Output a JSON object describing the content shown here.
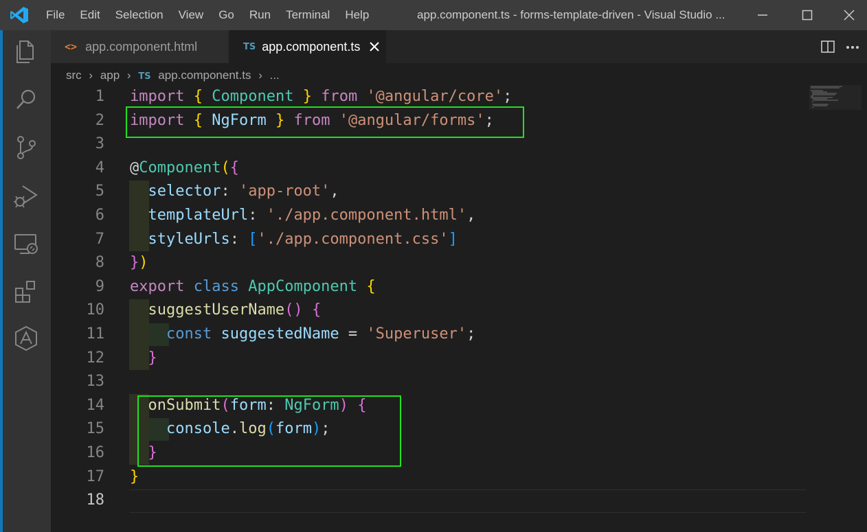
{
  "menu": [
    "File",
    "Edit",
    "Selection",
    "View",
    "Go",
    "Run",
    "Terminal",
    "Help"
  ],
  "window_title": "app.component.ts - forms-template-driven - Visual Studio ...",
  "tabs": [
    {
      "label": "app.component.html",
      "icon": "html-file-icon",
      "glyph": "<>",
      "active": false
    },
    {
      "label": "app.component.ts",
      "icon": "ts-file-icon",
      "glyph": "TS",
      "active": true
    }
  ],
  "breadcrumb": [
    "src",
    "app",
    "TS",
    "app.component.ts",
    "..."
  ],
  "line_numbers": [
    "1",
    "2",
    "3",
    "4",
    "5",
    "6",
    "7",
    "8",
    "9",
    "10",
    "11",
    "12",
    "13",
    "14",
    "15",
    "16",
    "17",
    "18"
  ],
  "code_lines": [
    [
      [
        "kw-import",
        "import"
      ],
      [
        "punc",
        " "
      ],
      [
        "b1",
        "{"
      ],
      [
        "punc",
        " "
      ],
      [
        "cls",
        "Component"
      ],
      [
        "punc",
        " "
      ],
      [
        "b1",
        "}"
      ],
      [
        "punc",
        " "
      ],
      [
        "kw-import",
        "from"
      ],
      [
        "punc",
        " "
      ],
      [
        "str",
        "'@angular/core'"
      ],
      [
        "punc",
        ";"
      ]
    ],
    [
      [
        "kw-import",
        "import"
      ],
      [
        "punc",
        " "
      ],
      [
        "b1",
        "{"
      ],
      [
        "punc",
        " "
      ],
      [
        "prop",
        "NgForm"
      ],
      [
        "punc",
        " "
      ],
      [
        "b1",
        "}"
      ],
      [
        "punc",
        " "
      ],
      [
        "kw-import",
        "from"
      ],
      [
        "punc",
        " "
      ],
      [
        "str",
        "'@angular/forms'"
      ],
      [
        "punc",
        ";"
      ]
    ],
    [],
    [
      [
        "punc",
        "@"
      ],
      [
        "cls",
        "Component"
      ],
      [
        "b1",
        "("
      ],
      [
        "b2",
        "{"
      ]
    ],
    [
      [
        "punc",
        "  "
      ],
      [
        "prop",
        "selector"
      ],
      [
        "punc",
        ": "
      ],
      [
        "str",
        "'app-root'"
      ],
      [
        "punc",
        ","
      ]
    ],
    [
      [
        "punc",
        "  "
      ],
      [
        "prop",
        "templateUrl"
      ],
      [
        "punc",
        ": "
      ],
      [
        "str",
        "'./app.component.html'"
      ],
      [
        "punc",
        ","
      ]
    ],
    [
      [
        "punc",
        "  "
      ],
      [
        "prop",
        "styleUrls"
      ],
      [
        "punc",
        ": "
      ],
      [
        "b3",
        "["
      ],
      [
        "str",
        "'./app.component.css'"
      ],
      [
        "b3",
        "]"
      ]
    ],
    [
      [
        "b2",
        "}"
      ],
      [
        "b1",
        ")"
      ]
    ],
    [
      [
        "kw-import",
        "export"
      ],
      [
        "punc",
        " "
      ],
      [
        "kw",
        "class"
      ],
      [
        "punc",
        " "
      ],
      [
        "cls",
        "AppComponent"
      ],
      [
        "punc",
        " "
      ],
      [
        "b1",
        "{"
      ]
    ],
    [
      [
        "punc",
        "  "
      ],
      [
        "fn",
        "suggestUserName"
      ],
      [
        "b2",
        "()"
      ],
      [
        "punc",
        " "
      ],
      [
        "b2",
        "{"
      ]
    ],
    [
      [
        "punc",
        "    "
      ],
      [
        "kw",
        "const"
      ],
      [
        "punc",
        " "
      ],
      [
        "var",
        "suggestedName"
      ],
      [
        "punc",
        " = "
      ],
      [
        "str",
        "'Superuser'"
      ],
      [
        "punc",
        ";"
      ]
    ],
    [
      [
        "punc",
        "  "
      ],
      [
        "b2",
        "}"
      ]
    ],
    [],
    [
      [
        "punc",
        "  "
      ],
      [
        "fn",
        "onSubmit"
      ],
      [
        "b2",
        "("
      ],
      [
        "var",
        "form"
      ],
      [
        "punc",
        ": "
      ],
      [
        "cls",
        "NgForm"
      ],
      [
        "b2",
        ")"
      ],
      [
        "punc",
        " "
      ],
      [
        "b2",
        "{"
      ]
    ],
    [
      [
        "punc",
        "    "
      ],
      [
        "var",
        "console"
      ],
      [
        "punc",
        "."
      ],
      [
        "fn",
        "log"
      ],
      [
        "b3",
        "("
      ],
      [
        "var",
        "form"
      ],
      [
        "b3",
        ")"
      ],
      [
        "punc",
        ";"
      ]
    ],
    [
      [
        "punc",
        "  "
      ],
      [
        "b2",
        "}"
      ]
    ],
    [
      [
        "b1",
        "}"
      ]
    ],
    []
  ],
  "current_line": "18",
  "colors": {
    "activity_accent": "#1177bb",
    "highlight_box": "#22e022"
  }
}
